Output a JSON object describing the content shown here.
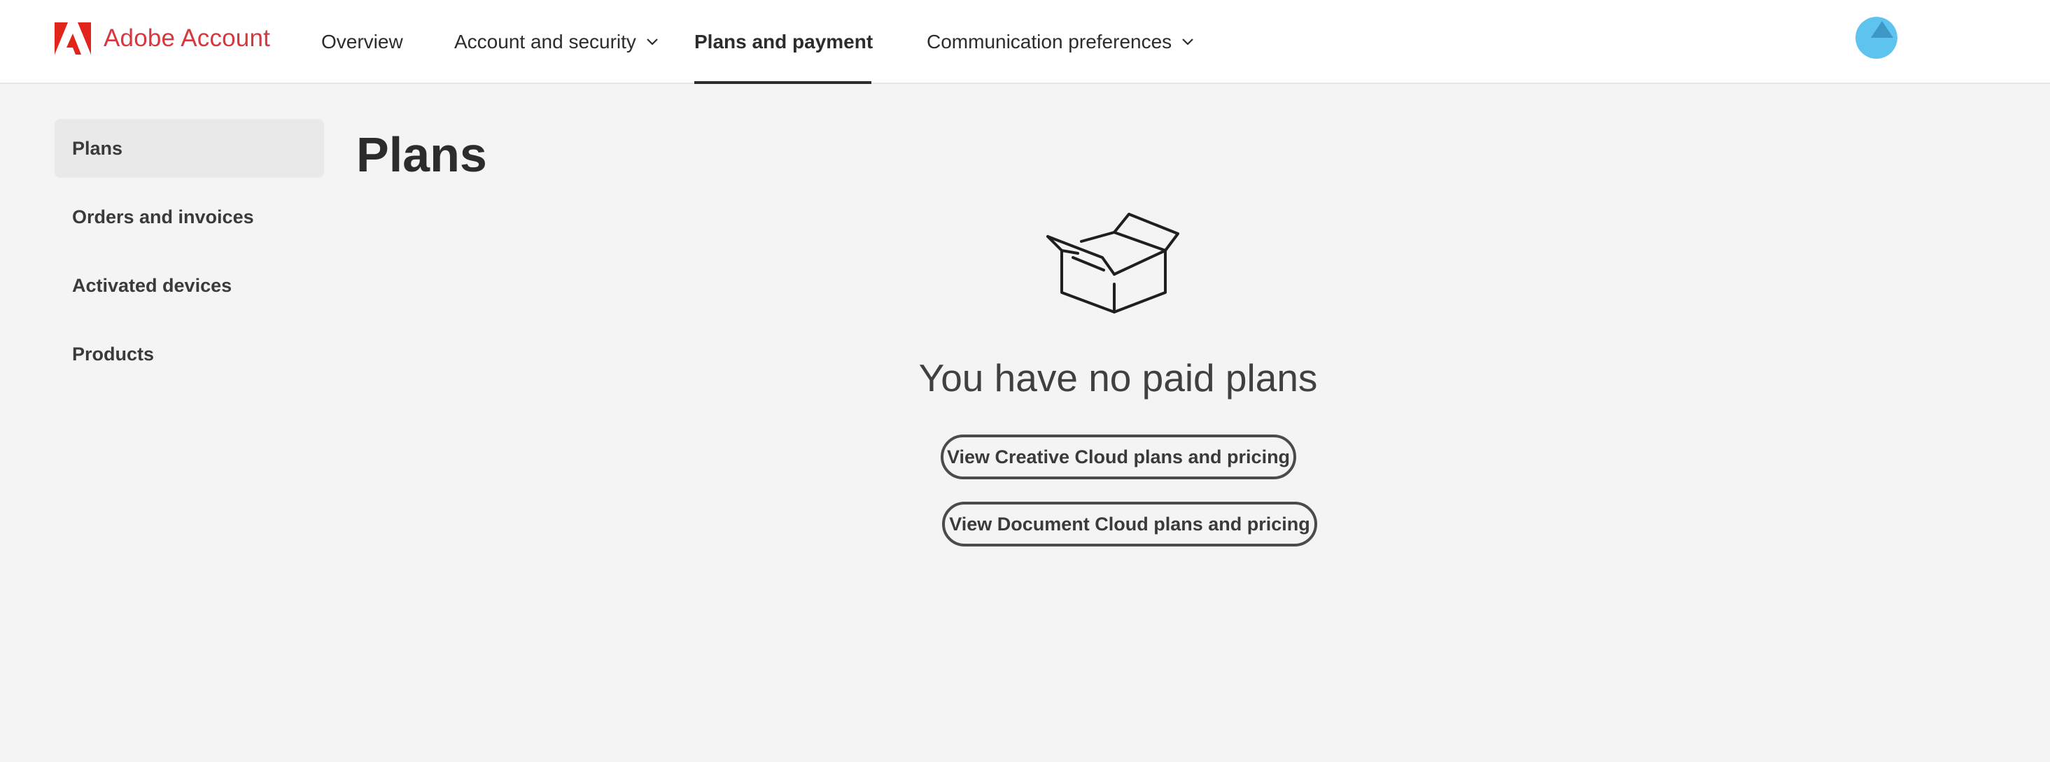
{
  "header": {
    "brand": "Adobe Account",
    "brand_color": "#d7373f",
    "nav": [
      {
        "label": "Overview",
        "has_dropdown": false,
        "active": false
      },
      {
        "label": "Account and security",
        "has_dropdown": true,
        "active": false
      },
      {
        "label": "Plans and payment",
        "has_dropdown": true,
        "active": true
      },
      {
        "label": "Communication preferences",
        "has_dropdown": true,
        "active": false
      }
    ],
    "avatar_icon": "user-avatar"
  },
  "sidebar": {
    "items": [
      {
        "label": "Plans",
        "selected": true
      },
      {
        "label": "Orders and invoices",
        "selected": false
      },
      {
        "label": "Activated devices",
        "selected": false
      },
      {
        "label": "Products",
        "selected": false
      }
    ]
  },
  "main": {
    "title": "Plans",
    "empty_icon": "open-box-icon",
    "empty_message": "You have no paid plans",
    "buttons": [
      {
        "label": "View Creative Cloud plans and pricing"
      },
      {
        "label": "View Document Cloud plans and pricing"
      }
    ]
  },
  "colors": {
    "background": "#f4f4f4",
    "header_background": "#ffffff",
    "text": "#2c2c2c",
    "sidebar_selected": "#e9e9e9",
    "avatar": "#5ec3ee"
  }
}
